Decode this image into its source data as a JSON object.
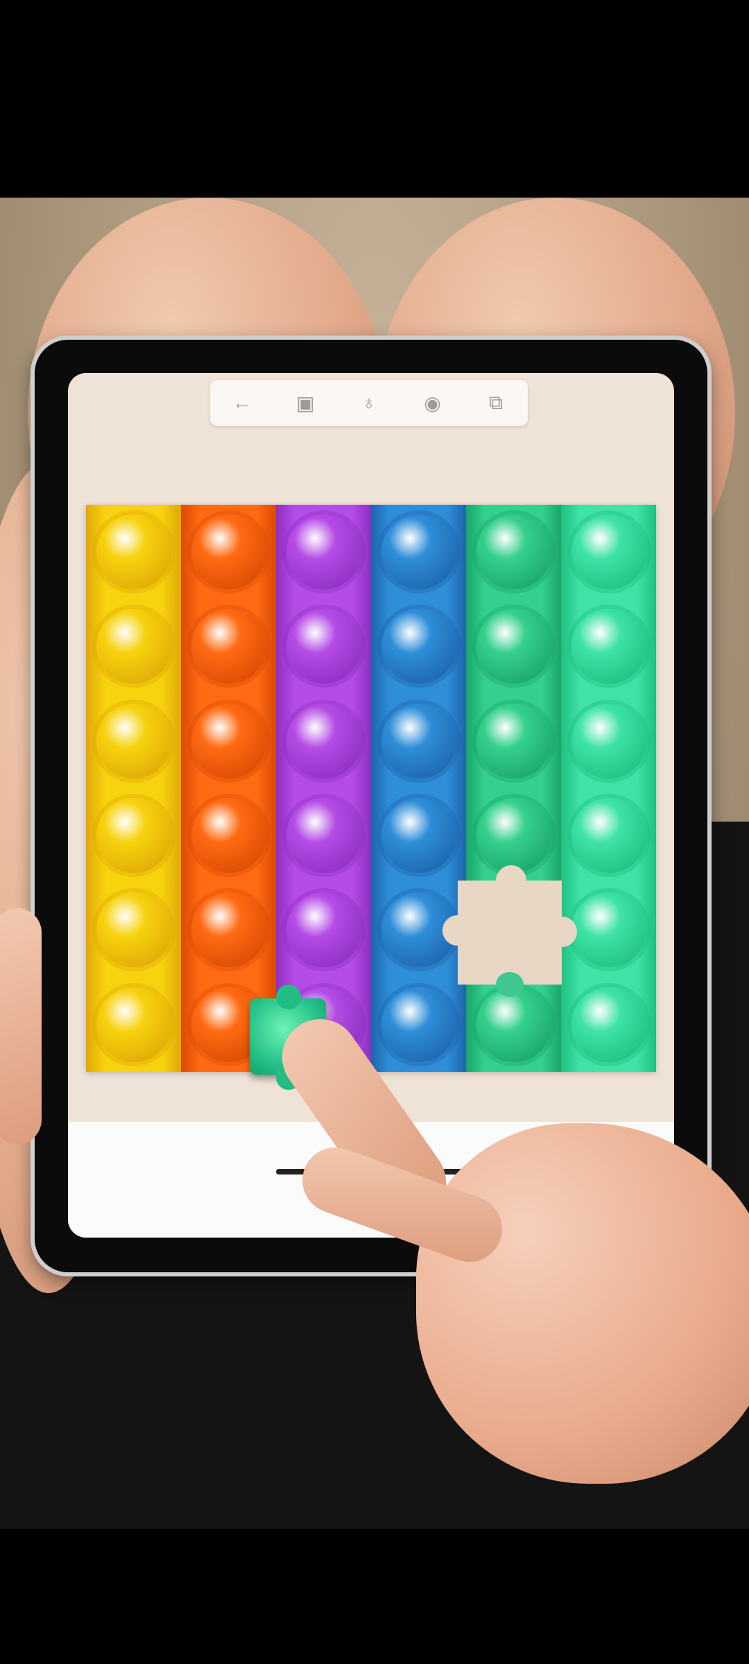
{
  "toolbar": {
    "tools": [
      {
        "icon": "back-arrow-icon",
        "glyph": "←"
      },
      {
        "icon": "image-icon",
        "glyph": "▣"
      },
      {
        "icon": "hint-bulb-icon",
        "glyph": "♁"
      },
      {
        "icon": "eye-icon",
        "glyph": "◉"
      },
      {
        "icon": "gallery-icon",
        "glyph": "⧉"
      }
    ]
  },
  "puzzle": {
    "columns": [
      {
        "name": "yellow",
        "color": "#f7d20e",
        "shade": "#e0a806"
      },
      {
        "name": "orange",
        "color": "#ff6a12",
        "shade": "#d94b05"
      },
      {
        "name": "purple",
        "color": "#b54ce6",
        "shade": "#8e2fc2"
      },
      {
        "name": "blue",
        "color": "#2f8ed8",
        "shade": "#1d65ad"
      },
      {
        "name": "green",
        "color": "#35d08d",
        "shade": "#1aa568"
      },
      {
        "name": "mint",
        "color": "#3fe3a6",
        "shade": "#1fbf80"
      }
    ],
    "rows": 6
  }
}
